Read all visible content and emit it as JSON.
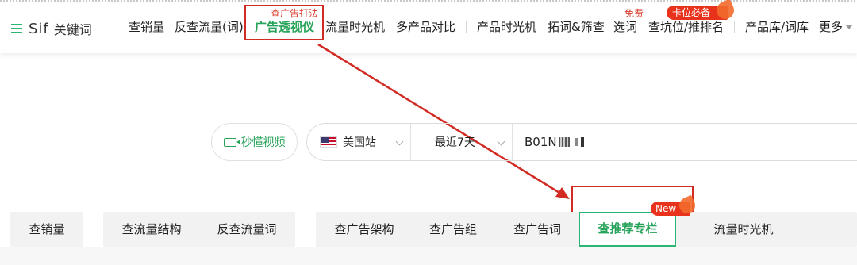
{
  "brand": {
    "name": "Sif",
    "suffix": "关键词"
  },
  "nav": {
    "items": [
      "查销量",
      "反查流量(词)",
      "广告透视仪",
      "流量时光机",
      "多产品对比",
      "产品时光机",
      "拓词&筛查",
      "选词",
      "查坑位/推排名",
      "产品库/词库",
      "更多"
    ],
    "active_index": 2,
    "hint_ad": "查广告打法",
    "hint_free": "免费",
    "badge_hot": "卡位必备"
  },
  "search": {
    "video_button": "秒懂视频",
    "country": "美国站",
    "range": "最近7天",
    "asin_prefix": "B01N"
  },
  "tabs": {
    "group1": [
      "查销量"
    ],
    "group2": [
      "查流量结构",
      "反查流量词"
    ],
    "group3": [
      "查广告架构",
      "查广告组",
      "查广告词",
      "查推荐专栏",
      "流量时光机"
    ],
    "active": "查推荐专栏",
    "badge_new": "New"
  },
  "colors": {
    "accent_green": "#27a35a",
    "highlight_red": "#d22b23",
    "badge_red": "#e8321c"
  }
}
